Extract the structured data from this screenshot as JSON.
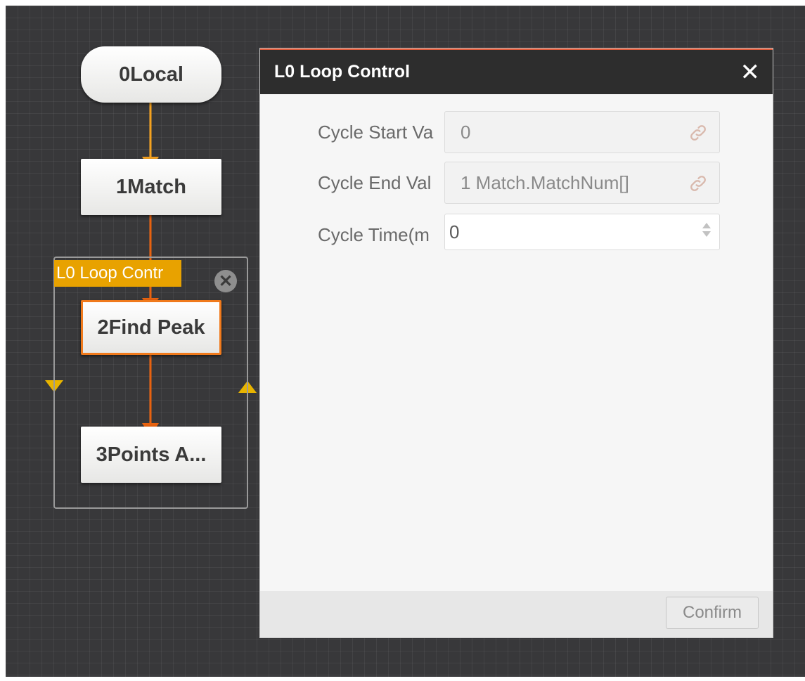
{
  "flow": {
    "nodes": [
      {
        "label": "0Local"
      },
      {
        "label": "1Match"
      },
      {
        "label": "2Find Peak"
      },
      {
        "label": "3Points A..."
      }
    ],
    "loop": {
      "tag": "L0 Loop Contr",
      "close_glyph": "✕"
    }
  },
  "dialog": {
    "title": "L0 Loop Control",
    "close_glyph": "✕",
    "fields": [
      {
        "label": "Cycle Start Va",
        "value": "0"
      },
      {
        "label": "Cycle End Val",
        "value": "1 Match.MatchNum[]"
      },
      {
        "label": "Cycle Time(m",
        "value": "0"
      }
    ],
    "confirm_label": "Confirm"
  },
  "colors": {
    "canvas": "#38383a",
    "arrow_orange": "#f5a21f",
    "arrow_dark_orange": "#e8620f",
    "loop_tag": "#e8a200",
    "dialog_header": "#2d2d2d"
  },
  "icons": [
    "link-icon",
    "close-icon",
    "spinner-up-icon",
    "spinner-down-icon",
    "loop-back-arrow-icon"
  ]
}
